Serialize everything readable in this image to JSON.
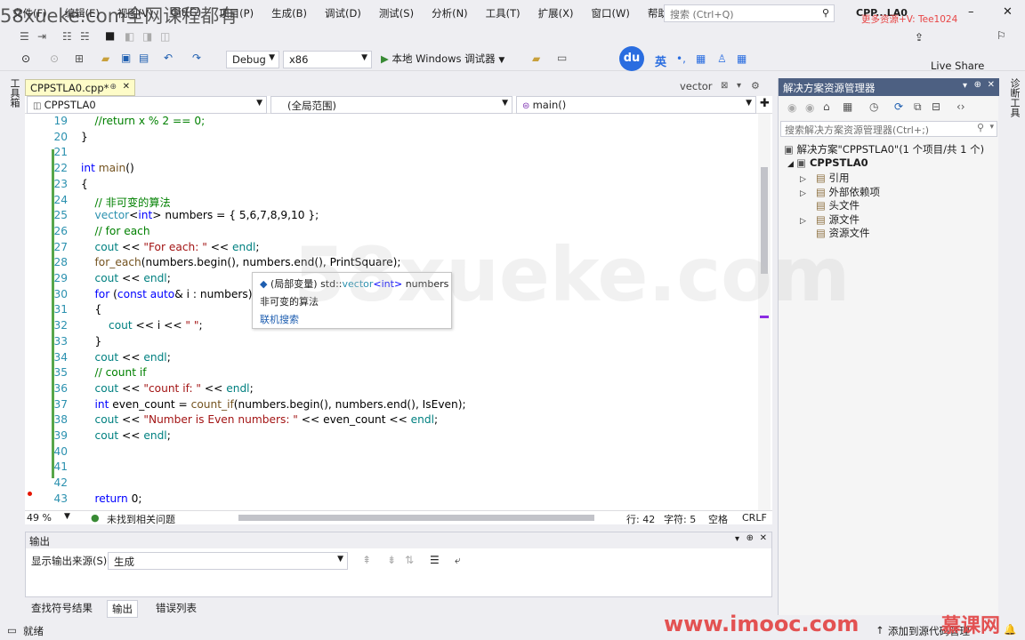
{
  "watermarks": {
    "top_left": "58xueke.com全网课程都有",
    "top_right": "更多资源+V: Tee1024",
    "bottom_right": "www.imooc.com",
    "bottom_right_brand": "慕课网",
    "center": "58xueke.com"
  },
  "menu": [
    "文件(F)",
    "编辑(E)",
    "视图(V)",
    "Git(G)",
    "项目(P)",
    "生成(B)",
    "调试(D)",
    "测试(S)",
    "分析(N)",
    "工具(T)",
    "扩展(X)",
    "窗口(W)",
    "帮助(H)"
  ],
  "search": {
    "placeholder": "搜索 (Ctrl+Q)"
  },
  "title_project": "CPP...LA0",
  "live_share": "Live Share",
  "toolbar": {
    "config": "Debug",
    "platform": "x86",
    "run_label": "本地 Windows 调试器"
  },
  "ime": {
    "du": "du",
    "lang": "英"
  },
  "left_strip_label": "工具箱",
  "right_strip_label": "诊断工具",
  "editor": {
    "tab": "CPPSTLA0.cpp*",
    "find_tab": "vector",
    "nav_project": "CPPSTLA0",
    "nav_scope": "(全局范围)",
    "nav_func": "main()",
    "zoom": "49 %",
    "issues": "未找到相关问题",
    "row": "行: 42",
    "col": "字符: 5",
    "spaces": "空格",
    "eol": "CRLF",
    "lines": [
      {
        "n": "19",
        "t": "        //return x % 2 == 0;"
      },
      {
        "n": "20",
        "t": "    }"
      },
      {
        "n": "21",
        "t": ""
      },
      {
        "n": "22",
        "t": "    int main()"
      },
      {
        "n": "23",
        "t": "    {"
      },
      {
        "n": "24",
        "t": "        // 非可变的算法"
      },
      {
        "n": "25",
        "t": "        vector<int> numbers = { 5,6,7,8,9,10 };"
      },
      {
        "n": "26",
        "t": "        // for each"
      },
      {
        "n": "27",
        "t": "        cout << \"For each: \" << endl;"
      },
      {
        "n": "28",
        "t": "        for_each(numbers.begin(), numbers.end(), PrintSquare);"
      },
      {
        "n": "29",
        "t": "        cout << endl;"
      },
      {
        "n": "30",
        "t": "        for (const auto& i : numbers)"
      },
      {
        "n": "31",
        "t": "        {"
      },
      {
        "n": "32",
        "t": "            cout << i << \" \";"
      },
      {
        "n": "33",
        "t": "        }"
      },
      {
        "n": "34",
        "t": "        cout << endl;"
      },
      {
        "n": "35",
        "t": "        // count if"
      },
      {
        "n": "36",
        "t": "        cout << \"count if: \" << endl;"
      },
      {
        "n": "37",
        "t": "        int even_count = count_if(numbers.begin(), numbers.end(), IsEven);"
      },
      {
        "n": "38",
        "t": "        cout << \"Number is Even numbers: \" << even_count << endl;"
      },
      {
        "n": "39",
        "t": "        cout << endl;"
      },
      {
        "n": "40",
        "t": ""
      },
      {
        "n": "41",
        "t": ""
      },
      {
        "n": "42",
        "t": ""
      },
      {
        "n": "43",
        "t": "        return 0;"
      }
    ]
  },
  "tooltip": {
    "kind": "(局部变量)",
    "ns": "std::",
    "type": "vector",
    "tmpl": "<int>",
    "name": "numbers",
    "desc": "非可变的算法",
    "link": "联机搜索"
  },
  "solution": {
    "title": "解决方案资源管理器",
    "search": "搜索解决方案资源管理器(Ctrl+;)",
    "root": "解决方案\"CPPSTLA0\"(1 个项目/共 1 个)",
    "project": "CPPSTLA0",
    "items": [
      "引用",
      "外部依赖项",
      "头文件",
      "源文件",
      "资源文件"
    ]
  },
  "output": {
    "title": "输出",
    "source_label": "显示输出来源(S):",
    "source": "生成"
  },
  "bottom_tabs": [
    "查找符号结果",
    "输出",
    "错误列表"
  ],
  "status": {
    "ready": "就绪",
    "add_source": "添加到源代码管理"
  },
  "colors": {
    "title_bar": "#4d6082",
    "tab_bg": "#fefcc8",
    "accent": "#007acc"
  }
}
